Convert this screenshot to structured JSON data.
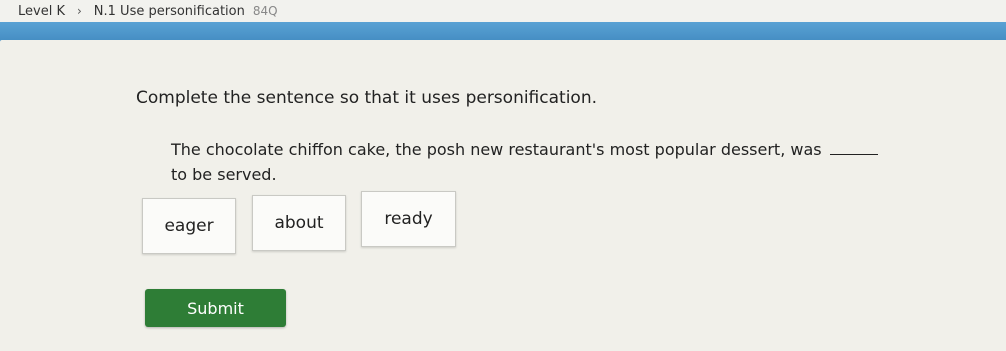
{
  "breadcrumb": {
    "level": "Level K",
    "separator": "›",
    "skill": "N.1 Use personification",
    "code": "84Q"
  },
  "question": {
    "prompt": "Complete the sentence so that it uses personification.",
    "sentence_before": "The chocolate chiffon cake, the posh new restaurant's most popular dessert, was",
    "sentence_after": "to be served."
  },
  "choices": [
    "eager",
    "about",
    "ready"
  ],
  "submit_label": "Submit",
  "colors": {
    "header_blue": "#4a93c9",
    "panel_bg": "#f1f0ea",
    "submit_green": "#2e7d36"
  }
}
